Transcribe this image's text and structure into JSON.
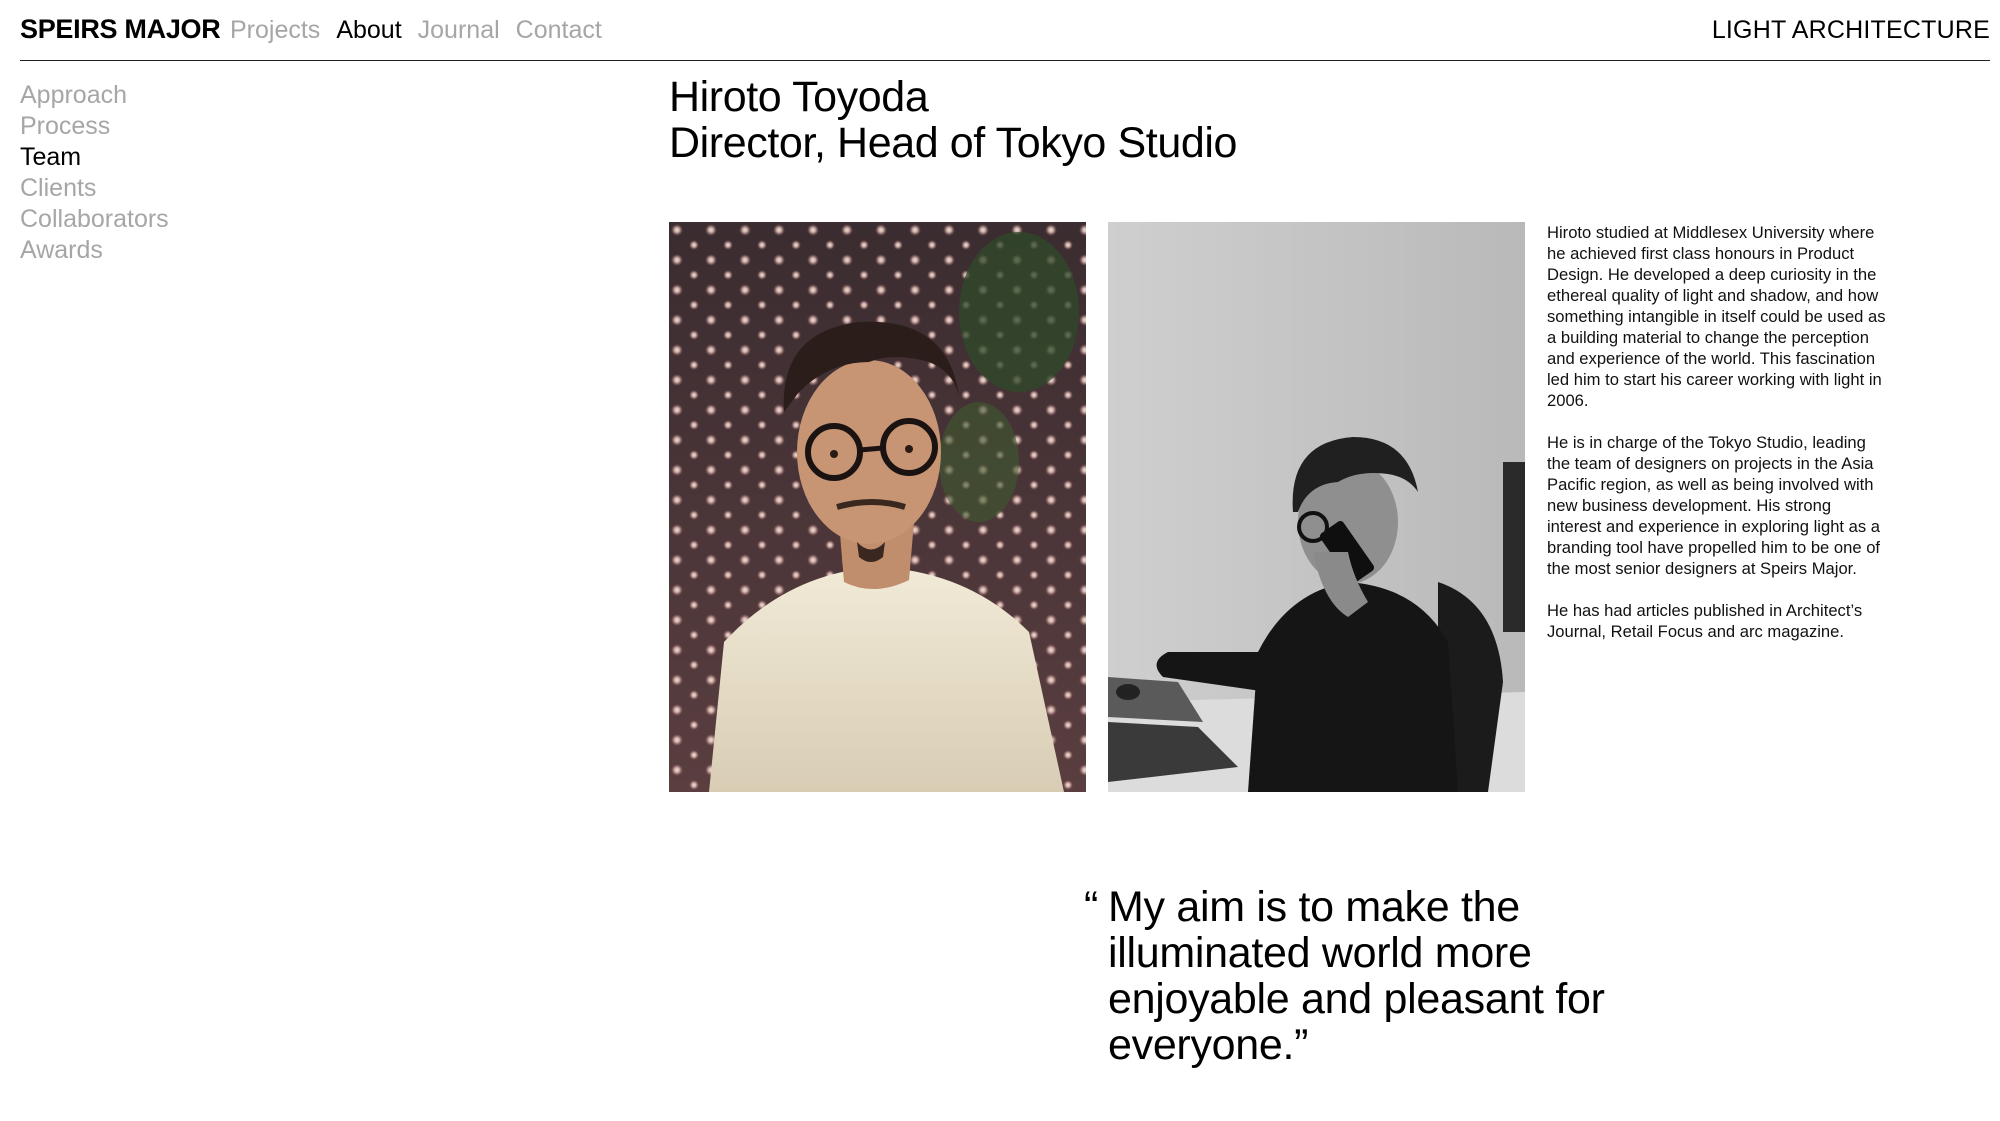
{
  "header": {
    "brand": "SPEIRS MAJOR",
    "nav": [
      {
        "label": "Projects",
        "active": false
      },
      {
        "label": "About",
        "active": true
      },
      {
        "label": "Journal",
        "active": false
      },
      {
        "label": "Contact",
        "active": false
      }
    ],
    "tagline": "LIGHT ARCHITECTURE"
  },
  "sidebar": {
    "items": [
      {
        "label": "Approach",
        "active": false
      },
      {
        "label": "Process",
        "active": false
      },
      {
        "label": "Team",
        "active": true
      },
      {
        "label": "Clients",
        "active": false
      },
      {
        "label": "Collaborators",
        "active": false
      },
      {
        "label": "Awards",
        "active": false
      }
    ]
  },
  "profile": {
    "name": "Hiroto Toyoda",
    "role": "Director, Head of Tokyo Studio",
    "bio": [
      "Hiroto studied at Middlesex University where he achieved first class honours in Product Design. He developed a deep curiosity in the ethereal quality of light and shadow, and how something intangible in itself could be used as a building material to change the perception and experience of the world. This fascination led him to start his career working with light in 2006.",
      "He is in charge of the Tokyo Studio, leading the team of designers on projects in the Asia Pacific region, as well as being involved with new business development. His strong interest and experience in exploring light as a branding tool have propelled him to be one of the most senior designers at Speirs Major.",
      "He has had articles published in Architect’s Journal, Retail Focus and arc magazine."
    ],
    "quote_open": "“",
    "quote": "My aim is to make the illuminated world more enjoyable and pleasant for everyone.”"
  },
  "colors": {
    "active_text": "#000000",
    "inactive_text": "#a6a6a6",
    "rule": "#222222"
  }
}
